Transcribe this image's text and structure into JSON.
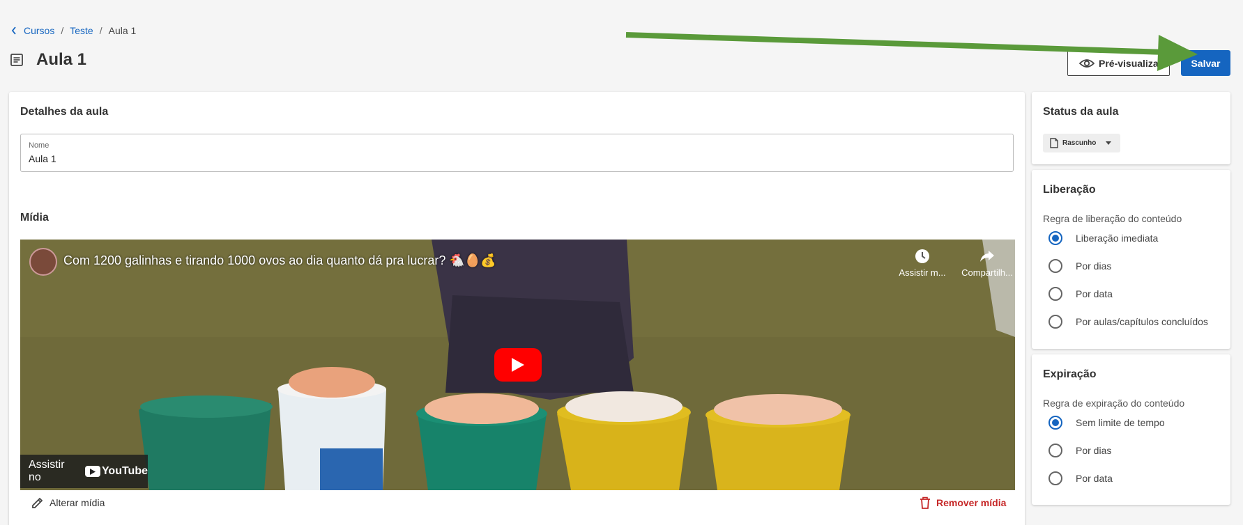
{
  "breadcrumb": {
    "items": [
      "Cursos",
      "Teste"
    ],
    "current": "Aula 1",
    "separator": "/"
  },
  "page": {
    "title": "Aula 1"
  },
  "actions": {
    "preview_label": "Pré-visualizar",
    "save_label": "Salvar"
  },
  "details": {
    "title": "Detalhes da aula",
    "name_label": "Nome",
    "name_value": "Aula 1",
    "media_title": "Mídia"
  },
  "video": {
    "title": "Com 1200 galinhas e tirando 1000 ovos ao dia quanto dá pra lucrar? 🐔🥚💰",
    "watch_later": "Assistir m...",
    "share": "Compartilh...",
    "watch_on": "Assistir no",
    "youtube": "YouTube"
  },
  "media_actions": {
    "alter": "Alterar mídia",
    "remove": "Remover mídia"
  },
  "status": {
    "title": "Status da aula",
    "value": "Rascunho"
  },
  "release": {
    "title": "Liberação",
    "subtitle": "Regra de liberação do conteúdo",
    "options": [
      "Liberação imediata",
      "Por dias",
      "Por data",
      "Por aulas/capítulos concluídos"
    ],
    "selected": "Liberação imediata"
  },
  "expiration": {
    "title": "Expiração",
    "subtitle": "Regra de expiração do conteúdo",
    "options": [
      "Sem limite de tempo",
      "Por dias",
      "Por data"
    ],
    "selected": "Sem limite de tempo"
  },
  "colors": {
    "primary": "#1565c0",
    "danger": "#c62828",
    "annotation_arrow": "#5a9a3a",
    "youtube_red": "#ff0000"
  },
  "icons": [
    "chevron-left-icon",
    "document-icon",
    "eye-icon",
    "clock-icon",
    "share-icon",
    "play-icon",
    "pencil-icon",
    "trash-icon",
    "file-icon",
    "caret-down-icon"
  ]
}
